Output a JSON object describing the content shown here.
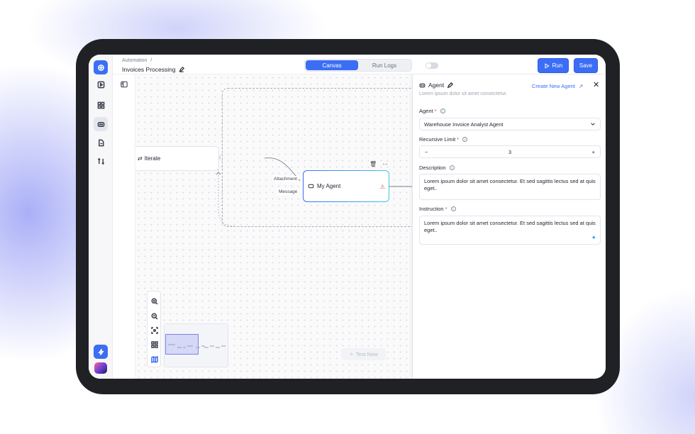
{
  "breadcrumb": {
    "parent": "Automation",
    "separator": "/"
  },
  "page": {
    "title": "Invoices Processing"
  },
  "tabs": [
    {
      "label": "Canvas",
      "active": true
    },
    {
      "label": "Run Logs",
      "active": false
    }
  ],
  "actions": {
    "run_label": "Run",
    "save_label": "Save"
  },
  "canvas": {
    "iterate_label": "Iterate",
    "agent_node_label": "My Agent",
    "input_labels": {
      "attachment": "Attachment",
      "message": "Message"
    },
    "test_now_label": "Test Now"
  },
  "panel": {
    "title": "Agent",
    "subtitle": "Lorem ipsum dolor sit amet consectetur.",
    "create_link": "Create New Agent",
    "agent": {
      "label": "Agent",
      "required": "*",
      "value": "Warehouse Invoice Analyst Agent"
    },
    "recursive_limit": {
      "label": "Recursive Limit",
      "required": "*",
      "value": "3",
      "minus": "−",
      "plus": "+"
    },
    "description": {
      "label": "Description",
      "value": "Lorem ipsum dolor sit amet consectetur. Et sed sagittis lectus sed at quis eget.."
    },
    "instruction": {
      "label": "Instruction",
      "required": "*",
      "value": "Lorem ipsum dolor sit amet consectetur. Et sed sagittis lectus sed at quis eget.."
    }
  },
  "colors": {
    "accent": "#3b6ef5",
    "warning": "#e04848"
  }
}
